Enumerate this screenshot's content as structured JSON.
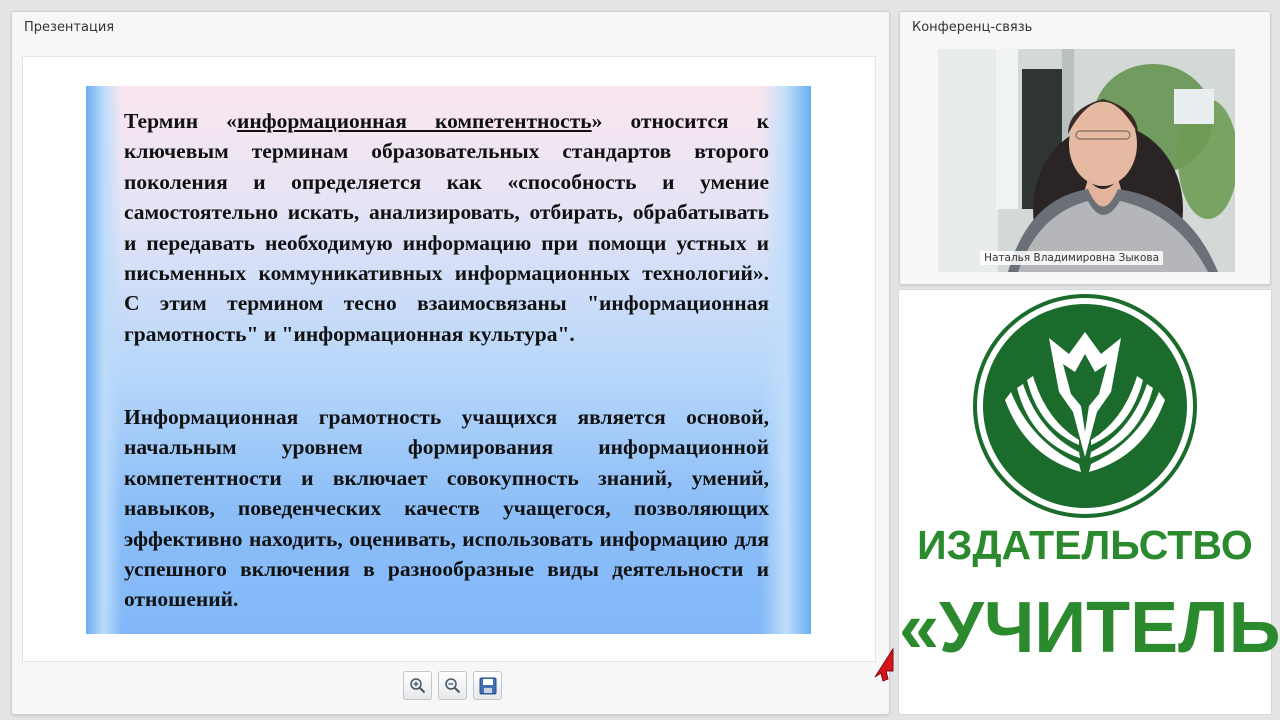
{
  "presentation": {
    "title": "Презентация",
    "slide": {
      "para1_before": "Термин «",
      "para1_term": "информационная компетентность",
      "para1_after": "» относится к ключевым терминам образовательных стандартов второго поколения и определяется как «способность и умение самостоятельно искать, анализировать, отбирать, обрабатывать и передавать необходимую информацию при помощи устных и письменных коммуникативных информационных технологий». С этим термином тесно взаимосвязаны \"информационная грамотность\" и \"информационная культура\".",
      "para2": "Информационная грамотность учащихся является основой, начальным уровнем формирования информационной компетентности и включает совокупность знаний, умений, навыков, поведенческих качеств учащегося, позволяющих эффективно находить, оценивать, использовать информацию для успешного включения в разнообразные виды деятельности и отношений."
    },
    "toolbar": {
      "icons": [
        "zoom-in-icon",
        "zoom-out-icon",
        "save-icon"
      ]
    }
  },
  "conference": {
    "title": "Конференц-связь",
    "speaker_name": "Наталья Владимировна Зыкова"
  },
  "publisher": {
    "line1": "ИЗДАТЕЛЬСТВО",
    "line2": "«УЧИТЕЛЬ»",
    "color": "#2c8a2e",
    "circle_color": "#1b6b2c"
  }
}
